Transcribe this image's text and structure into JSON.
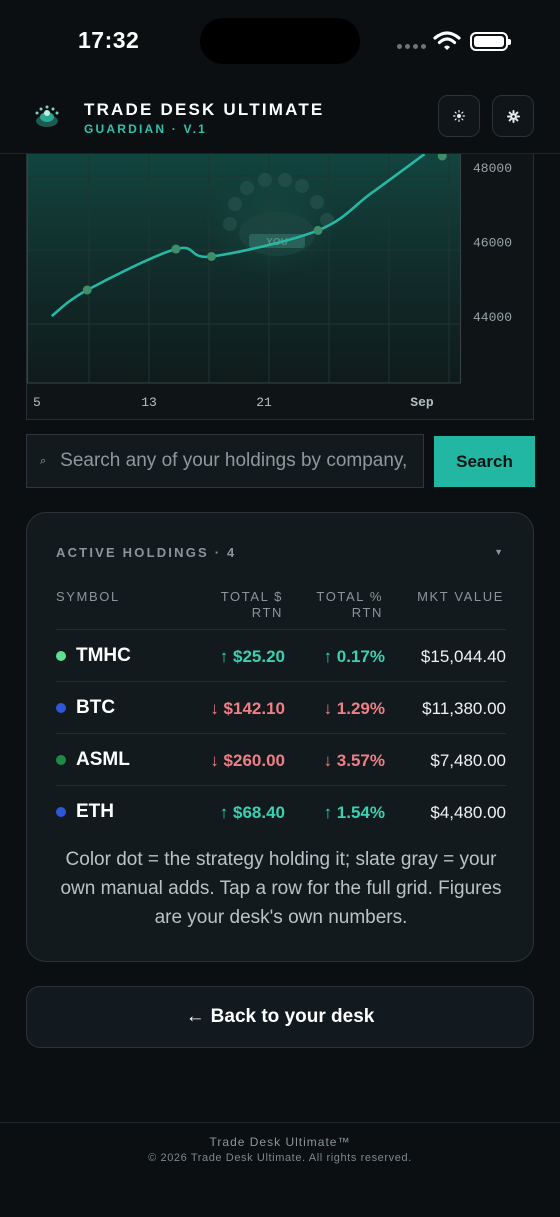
{
  "status_bar": {
    "time": "17:32"
  },
  "header": {
    "title": "TRADE DESK ULTIMATE",
    "subtitle": "GUARDIAN · V.1",
    "theme_icon": "sun-icon",
    "settings_icon": "gear-icon"
  },
  "chart_data": {
    "type": "line",
    "x": [
      6,
      8,
      13,
      15,
      21,
      24,
      27
    ],
    "y": [
      44000,
      44700,
      45800,
      45600,
      46300,
      47300,
      48350
    ],
    "points": [
      [
        8,
        44700
      ],
      [
        13,
        45800
      ],
      [
        15,
        45600
      ],
      [
        21,
        46300
      ],
      [
        28,
        48300
      ]
    ],
    "x_tick_labels": [
      "5",
      "13",
      "21",
      "Sep"
    ],
    "y_tick_labels": [
      "48000",
      "46000",
      "44000"
    ],
    "ylim": [
      42000,
      48400
    ],
    "grid": true,
    "watermark_text": "YOU",
    "colors": {
      "line": "#25b8a4",
      "points": "#3f8e6a",
      "fill": "#123a36"
    }
  },
  "search": {
    "placeholder": "Search any of your holdings by company, symbol or strategy",
    "button_label": "Search"
  },
  "holdings": {
    "title": "ACTIVE HOLDINGS · 4",
    "columns": {
      "symbol": "SYMBOL",
      "total_return": "TOTAL $\nRTN",
      "total_pct": "TOTAL %\nRTN",
      "market_value": "MKT VALUE"
    },
    "rows": [
      {
        "symbol": "TMHC",
        "dot_color": "#5fe091",
        "total_return": "↑ $25.20",
        "total_pct": "↑ 0.17%",
        "direction": "up",
        "market_value": "$15,044.40"
      },
      {
        "symbol": "BTC",
        "dot_color": "#2f55d8",
        "total_return": "↓ $142.10",
        "total_pct": "↓ 1.29%",
        "direction": "down",
        "market_value": "$11,380.00"
      },
      {
        "symbol": "ASML",
        "dot_color": "#1f8a46",
        "total_return": "↓ $260.00",
        "total_pct": "↓ 3.57%",
        "direction": "down",
        "market_value": "$7,480.00"
      },
      {
        "symbol": "ETH",
        "dot_color": "#2f55d8",
        "total_return": "↑ $68.40",
        "total_pct": "↑ 1.54%",
        "direction": "up",
        "market_value": "$4,480.00"
      }
    ],
    "note": "Color dot = the strategy holding it; slate gray = your own manual adds. Tap a row for the full grid. Figures are your desk's own numbers."
  },
  "back_button": {
    "label": "Back to your desk",
    "arrow": "←"
  },
  "footer": {
    "brand": "Trade Desk Ultimate™",
    "copyright": "© 2026 Trade Desk Ultimate. All rights reserved."
  }
}
